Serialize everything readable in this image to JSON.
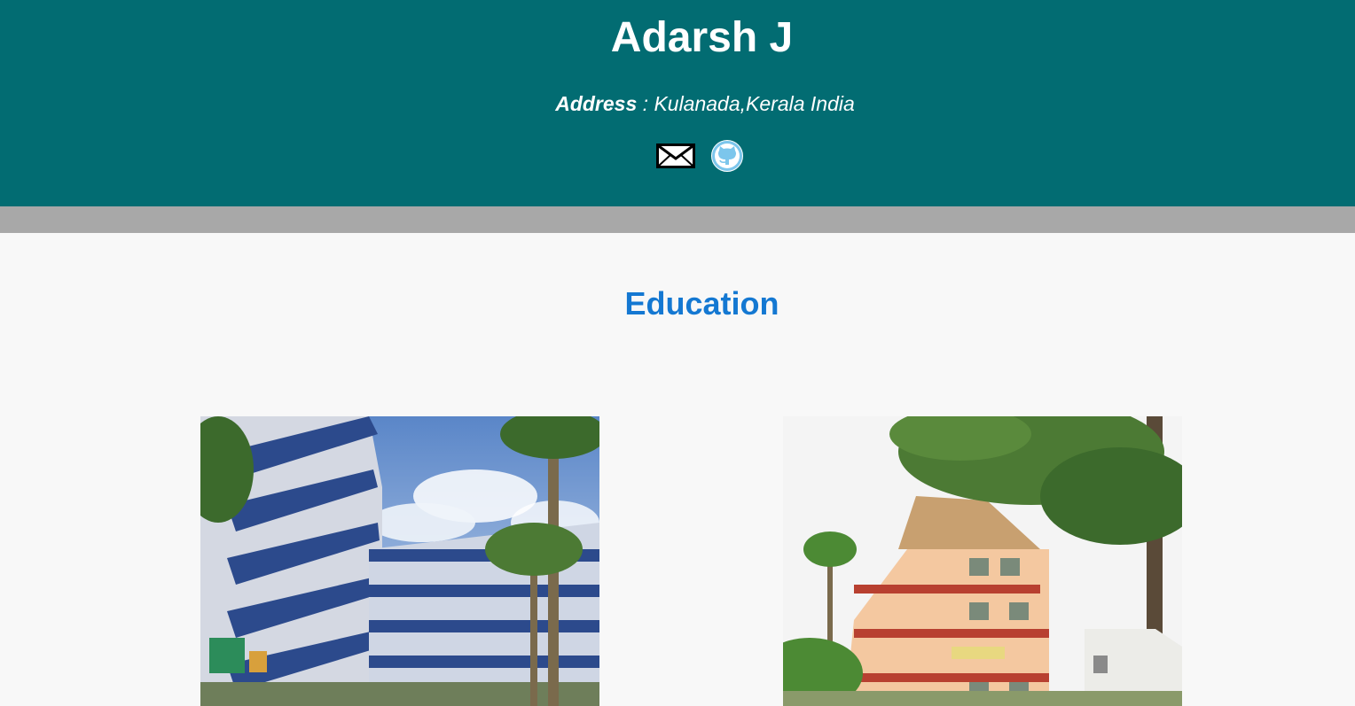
{
  "header": {
    "name": "Adarsh J",
    "address_label": "Address",
    "address_separator": " : ",
    "address_value": "Kulanada,Kerala India",
    "icons": [
      {
        "name": "email-icon"
      },
      {
        "name": "github-icon"
      }
    ]
  },
  "education": {
    "title": "Education",
    "photos": [
      {
        "name": "college-building-photo"
      },
      {
        "name": "school-building-photo"
      }
    ]
  },
  "colors": {
    "header_bg": "#026c72",
    "divider": "#a8a8a8",
    "section_title": "#1478d2",
    "page_bg": "#f8f8f8"
  }
}
